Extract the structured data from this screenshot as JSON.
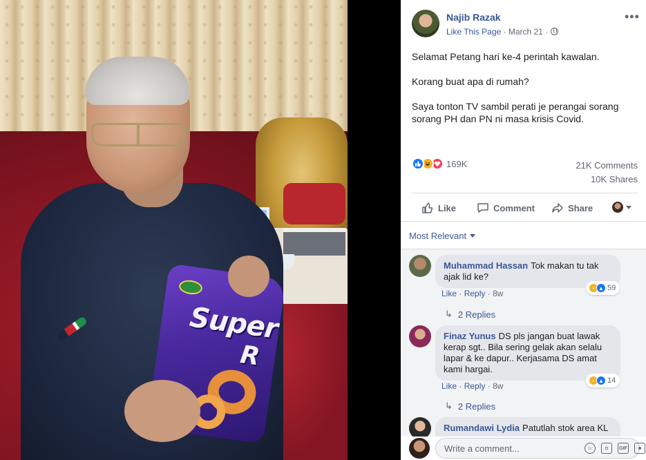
{
  "post": {
    "author": "Najib Razak",
    "like_page": "Like This Page",
    "separator": "·",
    "date": "March 21",
    "separator2": "·",
    "more": "•••",
    "body": [
      "Selamat Petang hari ke-4 perintah kawalan.",
      "Korang buat apa di rumah?",
      "Saya tonton TV sambil perati je perangai sorang sorang PH dan PN ni masa krisis Covid."
    ],
    "reactions_count": "169K",
    "comments_count": "21K Comments",
    "shares_count": "10K Shares"
  },
  "actions": {
    "like": "Like",
    "comment": "Comment",
    "share": "Share"
  },
  "comments_section": {
    "sort_label": "Most Relevant",
    "comments": [
      {
        "name": "Muhammad Hassan",
        "text": "Tok makan tu tak ajak lid ke?",
        "like": "Like",
        "reply": "Reply",
        "time": "8w",
        "reactions": "59",
        "replies": "2 Replies"
      },
      {
        "name": "Finaz Yunus",
        "text": "DS pls jangan buat lawak kerap sgt.. Bila sering gelak akan selalu lapar & ke dapur.. Kerjasama DS amat kami hargai.",
        "like": "Like",
        "reply": "Reply",
        "time": "8w",
        "reactions": "14",
        "replies": "2 Replies"
      },
      {
        "name": "Rumandawi Lydia",
        "text": "Patutlah stok area KL"
      }
    ],
    "dot": "·"
  },
  "write_comment": {
    "placeholder": "Write a comment...",
    "gif": "GIF"
  },
  "photo": {
    "bag_brand": "Super",
    "bag_letter": "R"
  },
  "colors": {
    "link_blue": "#385898",
    "like_blue": "#1877f2",
    "love_red": "#f33e58",
    "haha_yellow": "#f7b125"
  }
}
